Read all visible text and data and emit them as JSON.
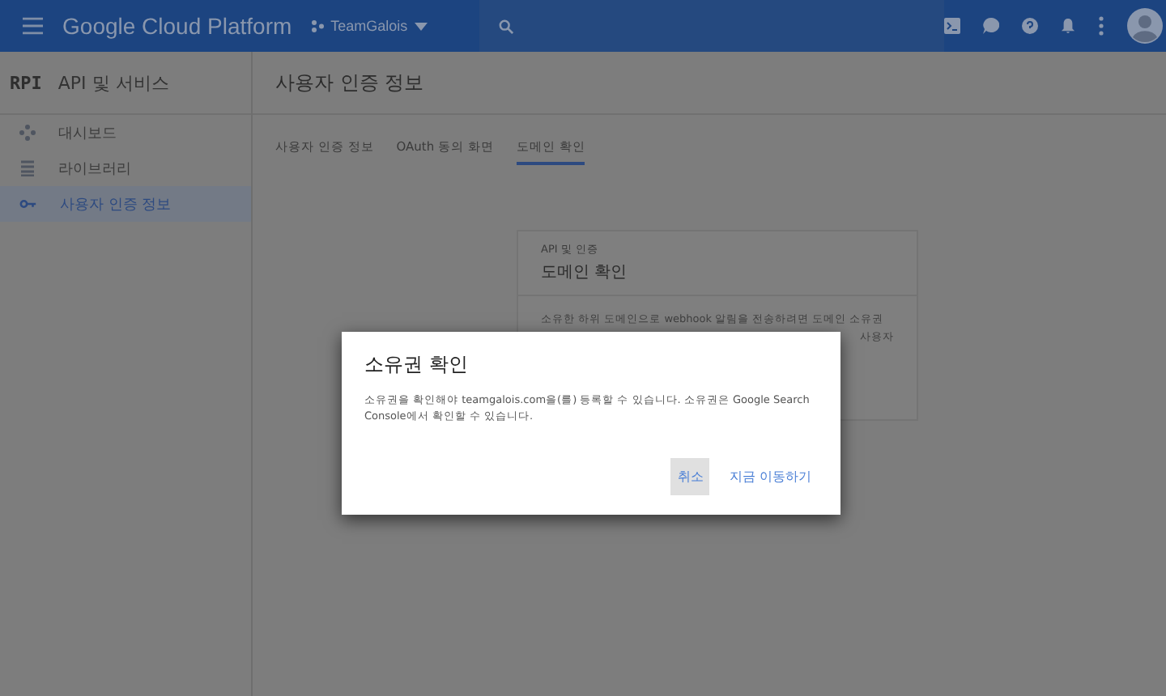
{
  "topbar": {
    "brand": "Google Cloud Platform",
    "project": "TeamGalois"
  },
  "sidebar": {
    "logo": "RPI",
    "title": "API 및 서비스",
    "items": [
      {
        "label": "대시보드",
        "kind": "dashboard",
        "selected": false
      },
      {
        "label": "라이브러리",
        "kind": "library",
        "selected": false
      },
      {
        "label": "사용자 인증 정보",
        "kind": "key",
        "selected": true
      }
    ]
  },
  "page": {
    "title": "사용자 인증 정보",
    "tabs": [
      {
        "label": "사용자 인증 정보",
        "selected": false
      },
      {
        "label": "OAuth 동의 화면",
        "selected": false
      },
      {
        "label": "도메인 확인",
        "selected": true
      }
    ]
  },
  "card": {
    "overline": "API 및 인증",
    "title": "도메인 확인",
    "body": "소유한 하위 도메인으로 webhook 알림을 전송하려면 도메인 소유권",
    "body_2": "사용자"
  },
  "dialog": {
    "title": "소유권 확인",
    "text": "소유권을 확인해야 teamgalois.com을(를) 등록할 수 있습니다. 소유권은 Google Search Console에서 확인할 수 있습니다.",
    "buttons": [
      {
        "label": "취소",
        "selected": true
      },
      {
        "label": "지금 이동하기",
        "selected": false
      }
    ]
  }
}
